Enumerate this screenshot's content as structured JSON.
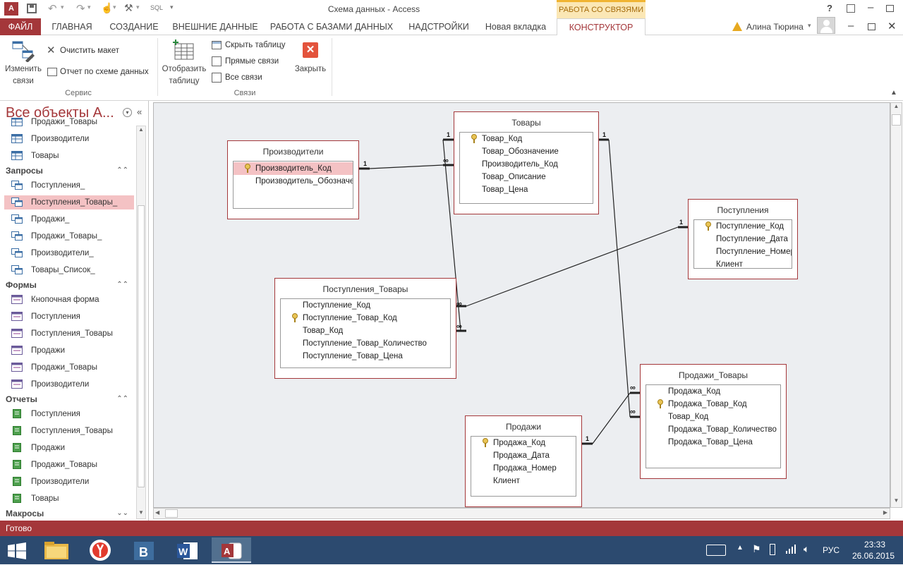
{
  "window": {
    "title": "Схема данных - Access",
    "context_tab_group": "РАБОТА СО СВЯЗЯМИ",
    "user": "Алина Тюрина",
    "help": "?",
    "sql_label": "SQL"
  },
  "tabs": [
    {
      "label": "ФАЙЛ"
    },
    {
      "label": "ГЛАВНАЯ"
    },
    {
      "label": "СОЗДАНИЕ"
    },
    {
      "label": "ВНЕШНИЕ ДАННЫЕ"
    },
    {
      "label": "РАБОТА С БАЗАМИ ДАННЫХ"
    },
    {
      "label": "НАДСТРОЙКИ"
    },
    {
      "label": "Новая вкладка"
    },
    {
      "label": "КОНСТРУКТОР"
    }
  ],
  "ribbon": {
    "edit_relationships": "Изменить связи",
    "edit_line1": "Изменить",
    "edit_line2": "связи",
    "clear_layout": "Очистить макет",
    "relationship_report": "Отчет по схеме данных",
    "service_group": "Сервис",
    "show_table_line1": "Отобразить",
    "show_table_line2": "таблицу",
    "hide_table": "Скрыть таблицу",
    "direct_relationships": "Прямые связи",
    "all_relationships": "Все связи",
    "close": "Закрыть",
    "relationships_group": "Связи"
  },
  "nav": {
    "title": "Все объекты А...",
    "items_top": [
      {
        "label": "Продажи_Товары",
        "icon": "table-icon"
      },
      {
        "label": "Производители",
        "icon": "table-icon"
      },
      {
        "label": "Товары",
        "icon": "table-icon"
      }
    ],
    "queries_header": "Запросы",
    "queries": [
      {
        "label": "Поступления_"
      },
      {
        "label": "Поступления_Товары_"
      },
      {
        "label": "Продажи_"
      },
      {
        "label": "Продажи_Товары_"
      },
      {
        "label": "Производители_"
      },
      {
        "label": "Товары_Список_"
      }
    ],
    "forms_header": "Формы",
    "forms": [
      {
        "label": "Кнопочная форма"
      },
      {
        "label": "Поступления"
      },
      {
        "label": "Поступления_Товары"
      },
      {
        "label": "Продажи"
      },
      {
        "label": "Продажи_Товары"
      },
      {
        "label": "Производители"
      }
    ],
    "reports_header": "Отчеты",
    "reports": [
      {
        "label": "Поступления"
      },
      {
        "label": "Поступления_Товары"
      },
      {
        "label": "Продажи"
      },
      {
        "label": "Продажи_Товары"
      },
      {
        "label": "Производители"
      },
      {
        "label": "Товары"
      }
    ],
    "macros_header": "Макросы"
  },
  "tables": {
    "manufacturers": {
      "title": "Производители",
      "fields": [
        {
          "name": "Производитель_Код",
          "key": true
        },
        {
          "name": "Производитель_Обозначение",
          "key": false
        }
      ]
    },
    "goods": {
      "title": "Товары",
      "fields": [
        {
          "name": "Товар_Код",
          "key": true
        },
        {
          "name": "Товар_Обозначение",
          "key": false
        },
        {
          "name": "Производитель_Код",
          "key": false
        },
        {
          "name": "Товар_Описание",
          "key": false
        },
        {
          "name": "Товар_Цена",
          "key": false
        }
      ]
    },
    "receipts": {
      "title": "Поступления",
      "fields": [
        {
          "name": "Поступление_Код",
          "key": true
        },
        {
          "name": "Поступление_Дата",
          "key": false
        },
        {
          "name": "Поступление_Номер",
          "key": false
        },
        {
          "name": "Клиент",
          "key": false
        }
      ]
    },
    "receipt_goods": {
      "title": "Поступления_Товары",
      "fields": [
        {
          "name": "Поступление_Код",
          "key": false
        },
        {
          "name": "Поступление_Товар_Код",
          "key": true
        },
        {
          "name": "Товар_Код",
          "key": false
        },
        {
          "name": "Поступление_Товар_Количество",
          "key": false
        },
        {
          "name": "Поступление_Товар_Цена",
          "key": false
        }
      ]
    },
    "sales_goods": {
      "title": "Продажи_Товары",
      "fields": [
        {
          "name": "Продажа_Код",
          "key": false
        },
        {
          "name": "Продажа_Товар_Код",
          "key": true
        },
        {
          "name": "Товар_Код",
          "key": false
        },
        {
          "name": "Продажа_Товар_Количество",
          "key": false
        },
        {
          "name": "Продажа_Товар_Цена",
          "key": false
        }
      ]
    },
    "sales": {
      "title": "Продажи",
      "fields": [
        {
          "name": "Продажа_Код",
          "key": true
        },
        {
          "name": "Продажа_Дата",
          "key": false
        },
        {
          "name": "Продажа_Номер",
          "key": false
        },
        {
          "name": "Клиент",
          "key": false
        }
      ]
    }
  },
  "relationships": {
    "one": "1",
    "many": "∞"
  },
  "status": {
    "text": "Готово"
  },
  "taskbar": {
    "lang": "РУС",
    "time": "23:33",
    "date": "26.06.2015"
  },
  "colors": {
    "accent": "#a4373a",
    "canvas": "#eceef1",
    "selected_row": "#f4c2c4",
    "taskbar": "#2c4a6f"
  }
}
